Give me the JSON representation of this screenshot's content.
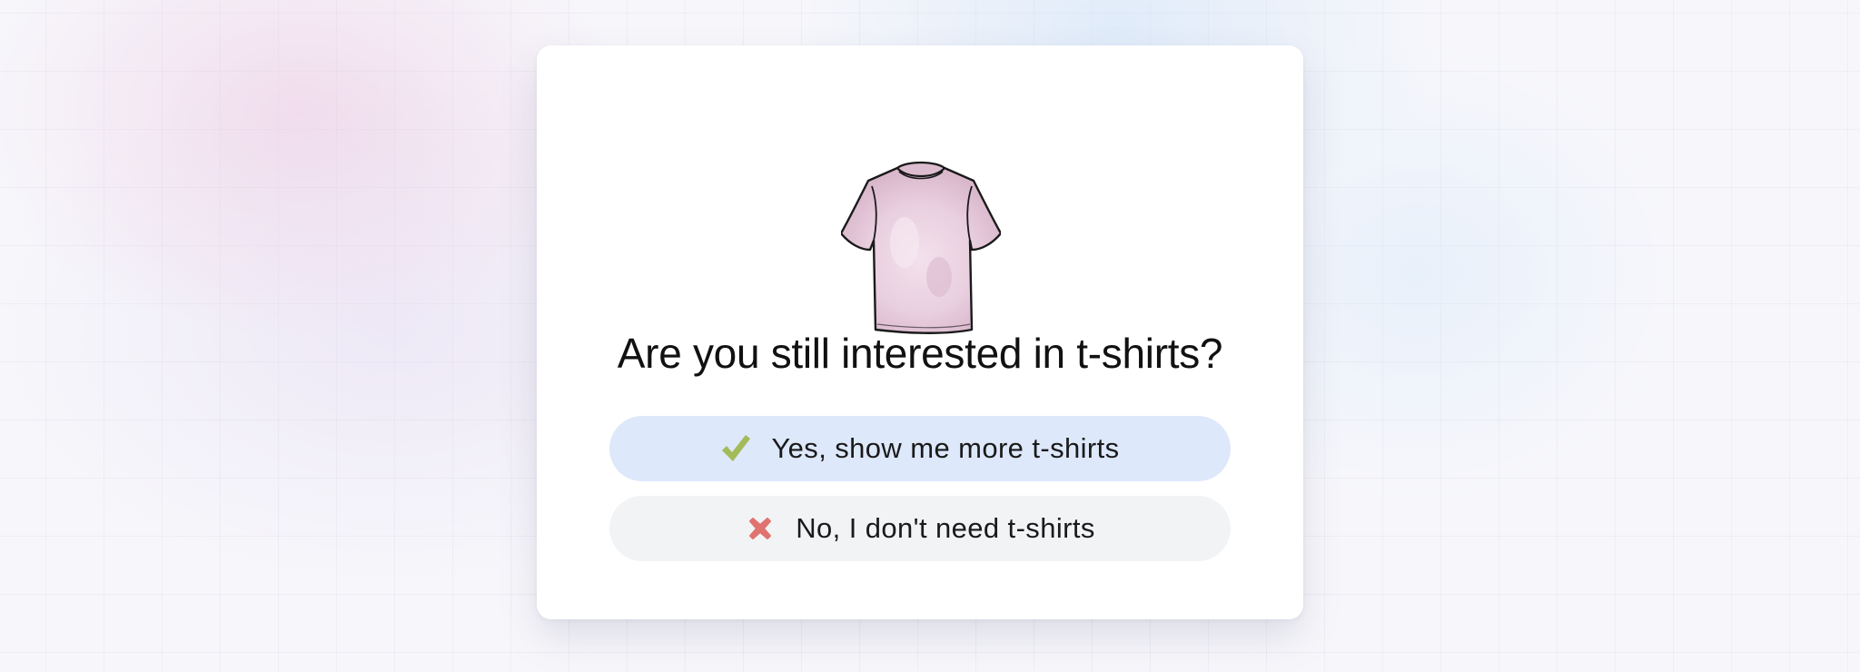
{
  "dialog": {
    "image": {
      "icon": "tshirt-illustration",
      "color": "#e9cfdf"
    },
    "question": "Are you still interested in t-shirts?",
    "options": [
      {
        "icon": "checkmark-icon",
        "icon_color": "#a3bb58",
        "label": "Yes, show me more t-shirts",
        "background": "#dde8fa"
      },
      {
        "icon": "cross-icon",
        "icon_color": "#e0736f",
        "label": "No, I don't need t-shirts",
        "background": "#f2f3f5"
      }
    ]
  }
}
